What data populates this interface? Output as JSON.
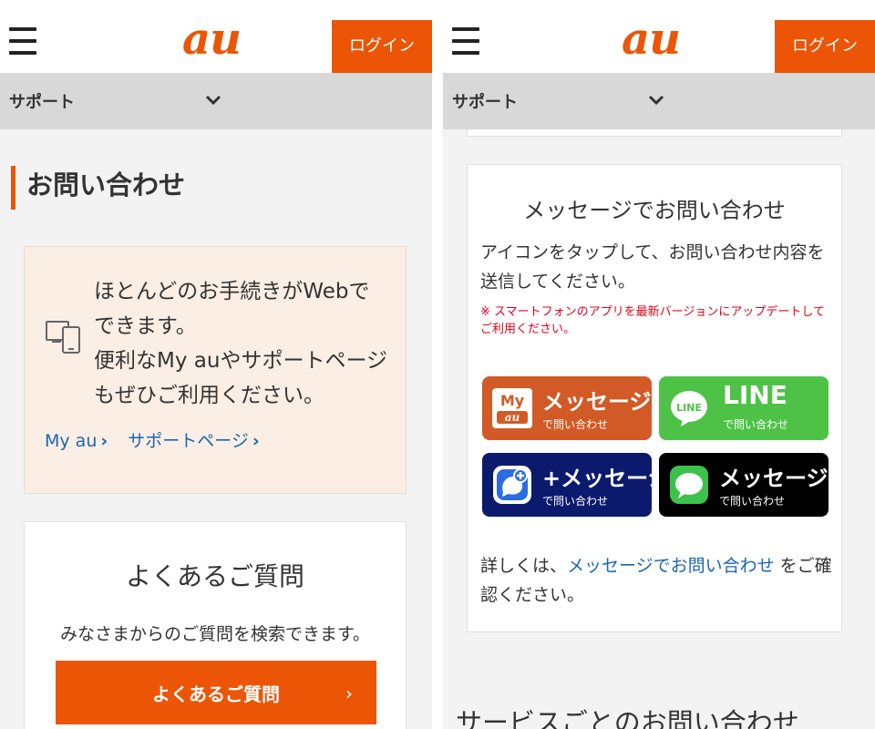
{
  "left": {
    "header": {
      "logo": "au",
      "login_label": "ログイン"
    },
    "subnav": {
      "label": "サポート"
    },
    "page_title": "お問い合わせ",
    "info": {
      "lines": [
        "ほとんどのお手続きがWebで",
        "できます。",
        "便利なMy auやサポートページ",
        "もぜひご利用ください。"
      ],
      "links": [
        {
          "label": "My au"
        },
        {
          "label": "サポートページ"
        }
      ]
    },
    "faq": {
      "title": "よくあるご質問",
      "description": "みなさまからのご質問を検索できます。",
      "button_label": "よくあるご質問",
      "button_arrow": "›"
    }
  },
  "right": {
    "header": {
      "logo": "au",
      "login_label": "ログイン"
    },
    "subnav": {
      "label": "サポート"
    },
    "message": {
      "title": "メッセージでお問い合わせ",
      "description": "アイコンをタップして、お問い合わせ内容を送信してください。",
      "note": "※ スマートフォンのアプリを最新バージョンにアップデートしてご利用ください。",
      "buttons": [
        {
          "main": "メッセージ",
          "sub": "で問い合わせ",
          "icon_label": "My",
          "icon_sub": "au",
          "icon": "myau-icon",
          "color": "#d25a26"
        },
        {
          "main": "LINE",
          "sub": "で問い合わせ",
          "icon_label": "LINE",
          "icon": "line-icon",
          "color": "#4dc247"
        },
        {
          "main": "+メッセージ",
          "sub": "で問い合わせ",
          "icon": "plus-message-icon",
          "color": "#0c1a6e"
        },
        {
          "main": "メッセージ",
          "sub": "で問い合わせ",
          "icon": "sms-icon",
          "color": "#000000"
        }
      ],
      "more_prefix": "詳しくは、",
      "more_link": "メッセージでお問い合わせ",
      "more_suffix": " をご確認ください。"
    },
    "next_heading": "サービスごとのお問い合わせ"
  },
  "colors": {
    "accent": "#eb5505",
    "link": "#1a66b3",
    "note_red": "#e60012"
  }
}
